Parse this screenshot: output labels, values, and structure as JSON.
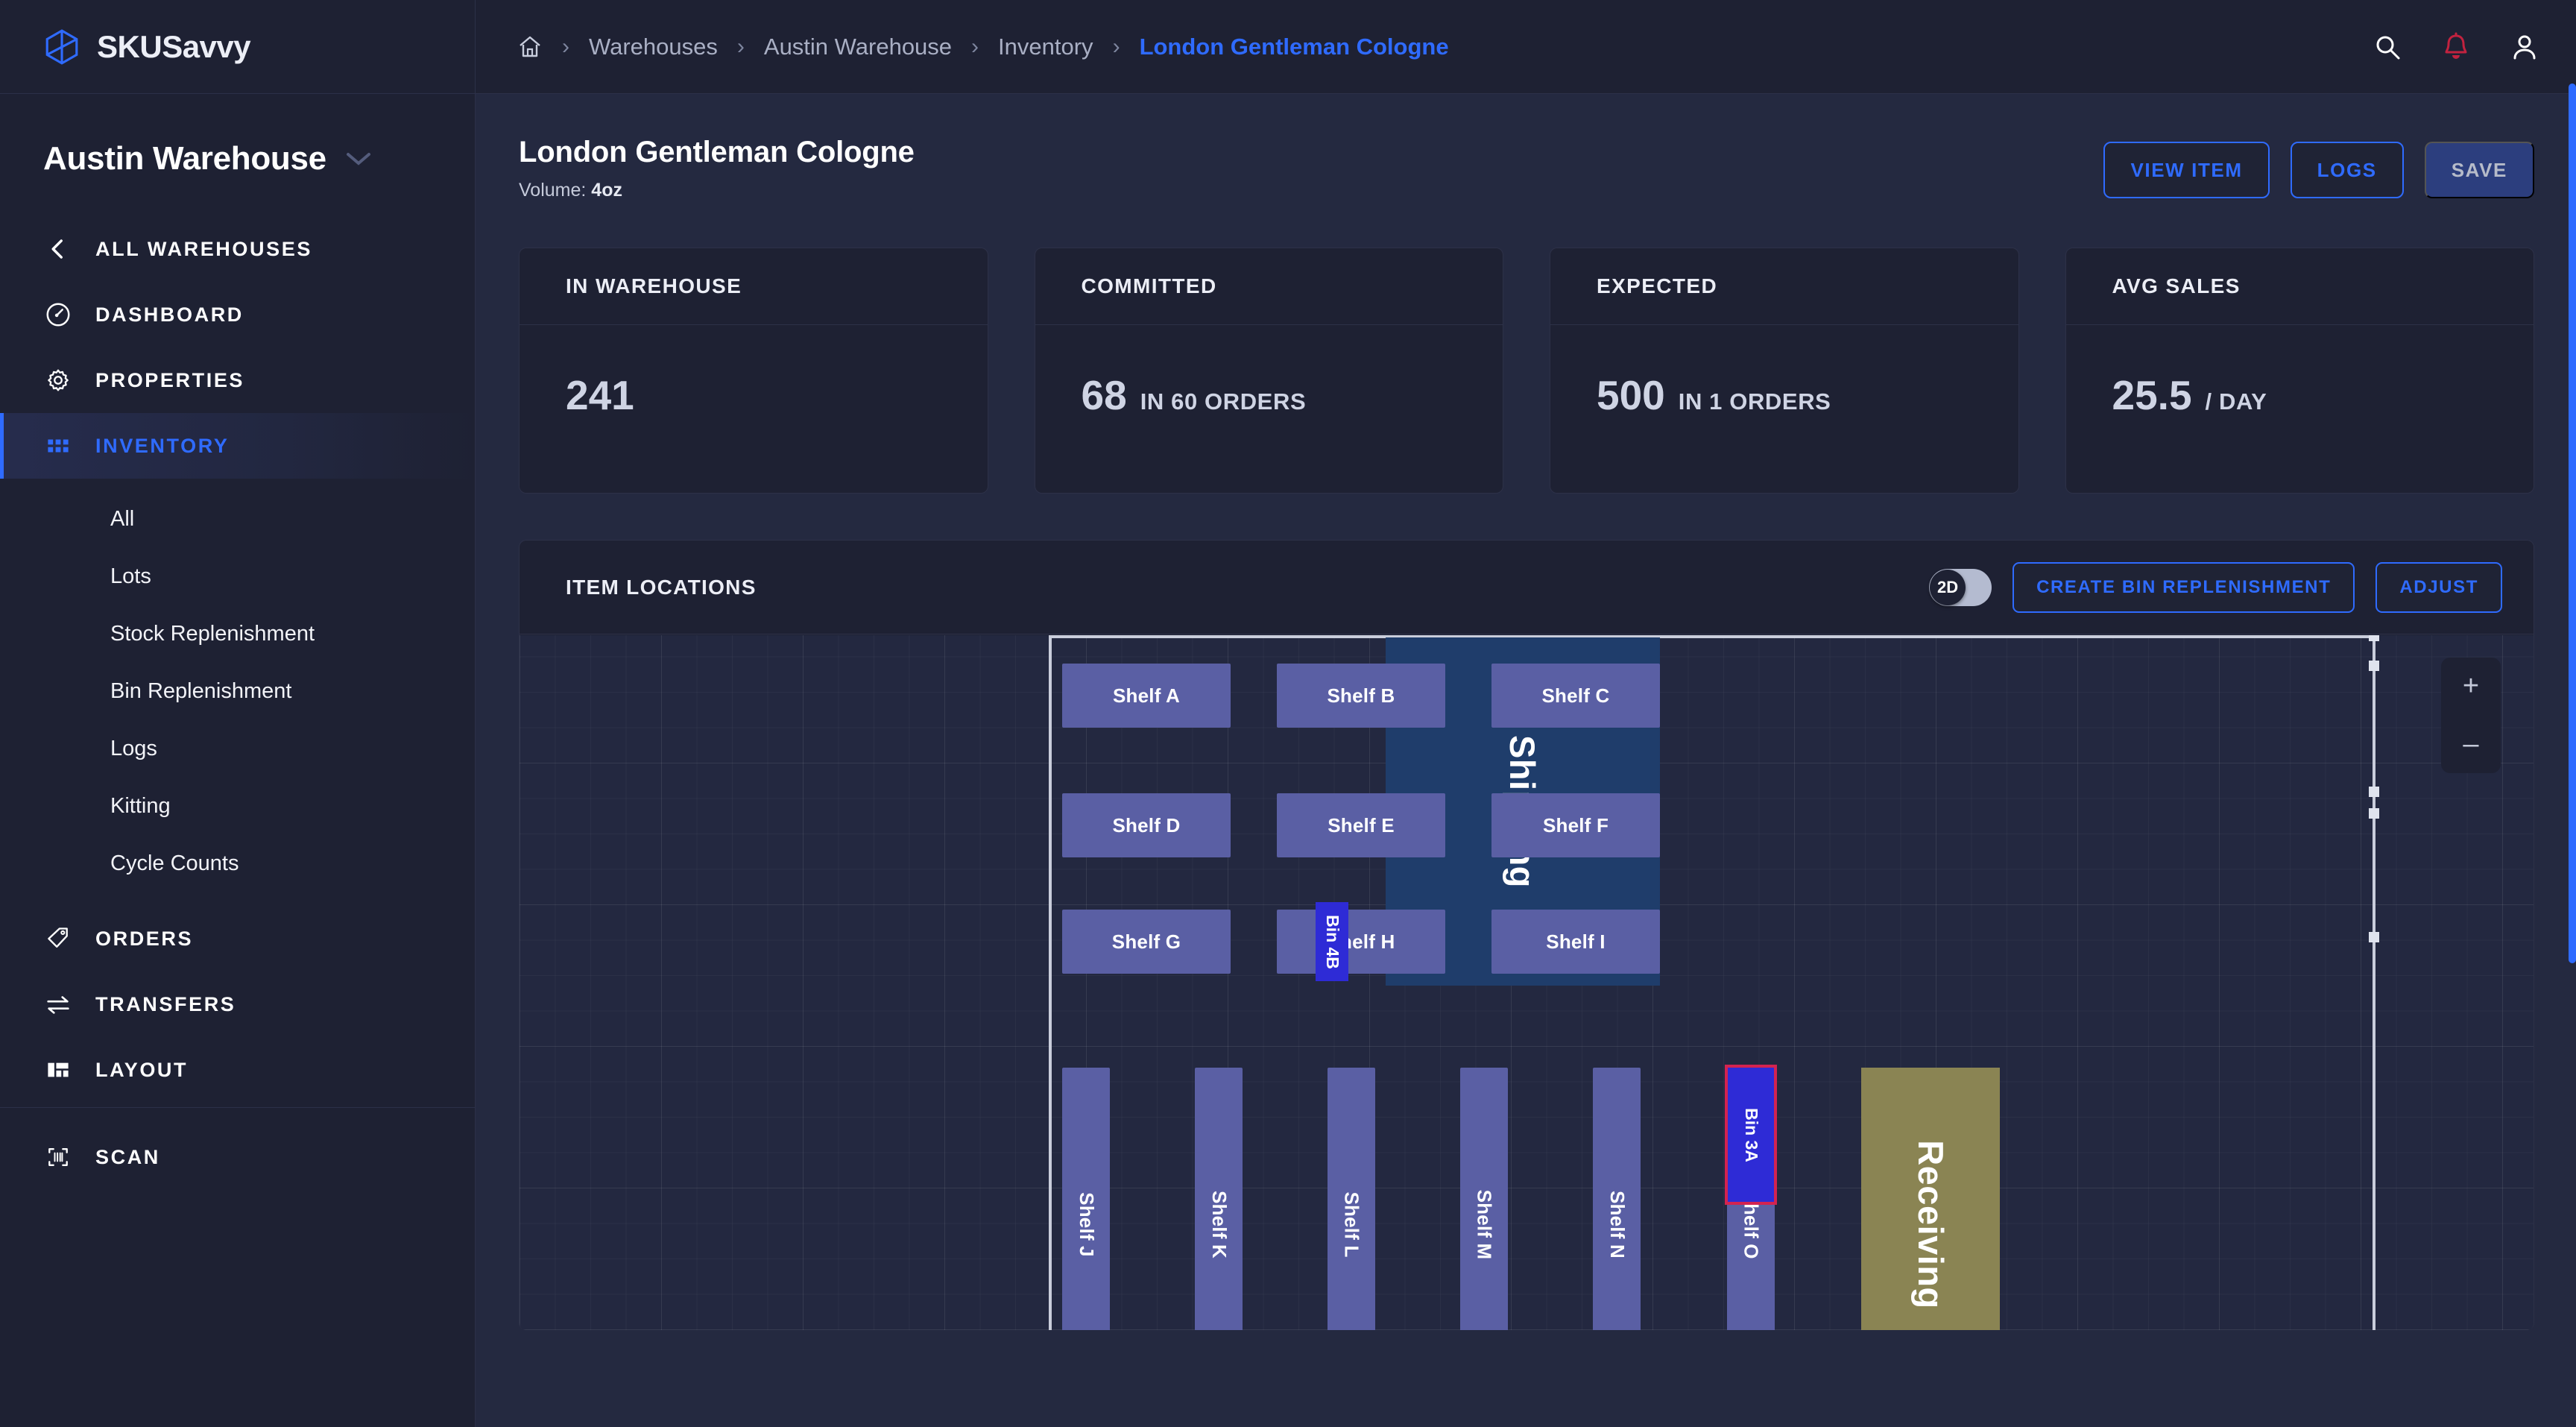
{
  "brand": {
    "name_prefix": "SKU",
    "name_suffix": "Savvy",
    "logo_icon": "cube-icon"
  },
  "sidebar": {
    "warehouse_name": "Austin Warehouse",
    "chevron_icon": "chevron-down-icon",
    "nav": [
      {
        "label": "ALL WAREHOUSES",
        "icon": "chevron-left-icon",
        "active": false
      },
      {
        "label": "DASHBOARD",
        "icon": "gauge-icon",
        "active": false
      },
      {
        "label": "PROPERTIES",
        "icon": "gear-icon",
        "active": false
      },
      {
        "label": "INVENTORY",
        "icon": "grid-icon",
        "active": true
      }
    ],
    "subnav": [
      {
        "label": "All"
      },
      {
        "label": "Lots"
      },
      {
        "label": "Stock Replenishment"
      },
      {
        "label": "Bin Replenishment"
      },
      {
        "label": "Logs"
      },
      {
        "label": "Kitting"
      },
      {
        "label": "Cycle Counts"
      }
    ],
    "nav_lower": [
      {
        "label": "ORDERS",
        "icon": "tag-icon"
      },
      {
        "label": "TRANSFERS",
        "icon": "transfer-arrows-icon"
      },
      {
        "label": "LAYOUT",
        "icon": "layout-icon"
      }
    ],
    "nav_footer": [
      {
        "label": "SCAN",
        "icon": "barcode-scan-icon"
      }
    ]
  },
  "topbar": {
    "home_icon": "home-icon",
    "breadcrumbs": [
      {
        "label": "Warehouses",
        "current": false
      },
      {
        "label": "Austin Warehouse",
        "current": false
      },
      {
        "label": "Inventory",
        "current": false
      },
      {
        "label": "London Gentleman Cologne",
        "current": true
      }
    ],
    "separator": "›",
    "icons": [
      {
        "name": "search-icon"
      },
      {
        "name": "bell-icon"
      },
      {
        "name": "user-icon"
      }
    ]
  },
  "page": {
    "title": "London Gentleman Cologne",
    "subtitle_label": "Volume:",
    "subtitle_value": "4oz",
    "actions": [
      {
        "label": "VIEW ITEM",
        "style": "outline"
      },
      {
        "label": "LOGS",
        "style": "outline"
      },
      {
        "label": "SAVE",
        "style": "primary"
      }
    ]
  },
  "stats": [
    {
      "title": "IN WAREHOUSE",
      "value": "241",
      "unit": ""
    },
    {
      "title": "COMMITTED",
      "value": "68",
      "unit": "IN 60 ORDERS"
    },
    {
      "title": "EXPECTED",
      "value": "500",
      "unit": "IN 1 ORDERS"
    },
    {
      "title": "AVG SALES",
      "value": "25.5",
      "unit": "/ DAY"
    }
  ],
  "locations_panel": {
    "title": "ITEM LOCATIONS",
    "view_toggle": {
      "label": "2D",
      "state": "on"
    },
    "buttons": [
      {
        "label": "CREATE BIN REPLENISHMENT"
      },
      {
        "label": "ADJUST"
      }
    ],
    "zoom_controls": {
      "zoom_in": "+",
      "zoom_out": "–"
    }
  },
  "map": {
    "shelves_horizontal": [
      {
        "label": "Shelf A"
      },
      {
        "label": "Shelf B"
      },
      {
        "label": "Shelf C"
      },
      {
        "label": "Shelf D"
      },
      {
        "label": "Shelf E"
      },
      {
        "label": "Shelf F"
      },
      {
        "label": "Shelf G"
      },
      {
        "label": "Shelf H"
      },
      {
        "label": "Shelf I"
      }
    ],
    "shelves_vertical": [
      {
        "label": "Shelf J"
      },
      {
        "label": "Shelf K"
      },
      {
        "label": "Shelf L"
      },
      {
        "label": "Shelf M"
      },
      {
        "label": "Shelf N"
      },
      {
        "label": "Shelf O"
      }
    ],
    "zones": [
      {
        "label": "Shipping",
        "color": "#1f3d6b"
      },
      {
        "label": "Receiving",
        "color": "#8a8453"
      }
    ],
    "bins": [
      {
        "label": "Bin 4B",
        "on_shelf": "Shelf H",
        "selected": false
      },
      {
        "label": "Bin 3A",
        "on_shelf": "Shelf O",
        "selected": true
      }
    ],
    "selection_color": "#d32350",
    "bin_color": "#2e2bd6",
    "shelf_color": "#5a5fa4"
  },
  "theme": {
    "accent": "#2f6bff",
    "sidebar_bg": "#1e2133",
    "main_bg": "#242940",
    "card_bg": "#1e2133",
    "alert": "#c2223f"
  }
}
